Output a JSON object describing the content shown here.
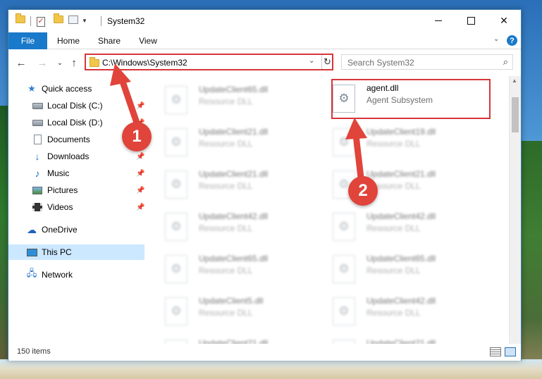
{
  "window": {
    "title": "System32",
    "controls": {
      "minimize": "",
      "maximize": "",
      "close": "✕"
    }
  },
  "ribbon": {
    "tabs": [
      "File",
      "Home",
      "Share",
      "View"
    ],
    "collapse": "⌄",
    "help": "?"
  },
  "address": {
    "path": "C:\\Windows\\System32",
    "dropdown": "⌄",
    "refresh": "↻"
  },
  "search": {
    "placeholder": "Search System32",
    "icon": "⌕"
  },
  "nav": {
    "back": "←",
    "forward": "→",
    "recent": "⌄",
    "up": "↑",
    "items": [
      {
        "label": "Quick access",
        "icon": "star-icon",
        "pinned": false
      },
      {
        "label": "Local Disk (C:)",
        "icon": "disk-icon",
        "pinned": true
      },
      {
        "label": "Local Disk (D:)",
        "icon": "disk-icon",
        "pinned": true
      },
      {
        "label": "Documents",
        "icon": "documents-icon",
        "pinned": true
      },
      {
        "label": "Downloads",
        "icon": "downloads-icon",
        "pinned": true
      },
      {
        "label": "Music",
        "icon": "music-icon",
        "pinned": true
      },
      {
        "label": "Pictures",
        "icon": "pictures-icon",
        "pinned": true
      },
      {
        "label": "Videos",
        "icon": "videos-icon",
        "pinned": true
      },
      {
        "label": "OneDrive",
        "icon": "onedrive-icon",
        "pinned": false
      },
      {
        "label": "This PC",
        "icon": "this-pc-icon",
        "pinned": false,
        "selected": true
      },
      {
        "label": "Network",
        "icon": "network-icon",
        "pinned": false
      }
    ]
  },
  "files": {
    "left_column": [
      {
        "name": "UpdateClient65.dll",
        "type": "Resource DLL"
      },
      {
        "name": "UpdateClient21.dll",
        "type": "Resource DLL"
      },
      {
        "name": "UpdateClient21.dll",
        "type": "Resource DLL"
      },
      {
        "name": "UpdateClient42.dll",
        "type": "Resource DLL"
      },
      {
        "name": "UpdateClient65.dll",
        "type": "Resource DLL"
      },
      {
        "name": "UpdateClient5.dll",
        "type": "Resource DLL"
      },
      {
        "name": "UpdateClient21.dll",
        "type": "Resource DLL"
      }
    ],
    "right_column": [
      {
        "name": "agent.dll",
        "type": "Agent Subsystem"
      },
      {
        "name": "UpdateClient19.dll",
        "type": "Resource DLL"
      },
      {
        "name": "UpdateClient21.dll",
        "type": "Resource DLL"
      },
      {
        "name": "UpdateClient42.dll",
        "type": "Resource DLL"
      },
      {
        "name": "UpdateClient65.dll",
        "type": "Resource DLL"
      },
      {
        "name": "UpdateClient42.dll",
        "type": "Resource DLL"
      },
      {
        "name": "UpdateClient21.dll",
        "type": "Resource DLL"
      }
    ]
  },
  "status": {
    "item_count": "150 items"
  },
  "callouts": [
    "1",
    "2"
  ],
  "colors": {
    "accent": "#1979ca",
    "annotation": "#d6353b",
    "selected": "#cce8ff"
  }
}
